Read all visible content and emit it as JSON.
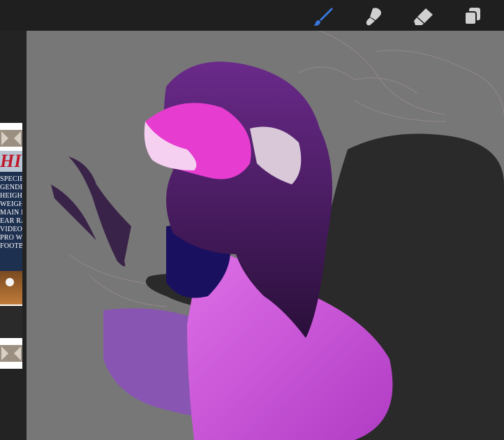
{
  "toolbar": {
    "tools": [
      {
        "name": "brush",
        "icon": "brush-icon",
        "active": true
      },
      {
        "name": "smudge",
        "icon": "smudge-icon",
        "active": false
      },
      {
        "name": "eraser",
        "icon": "eraser-icon",
        "active": false
      },
      {
        "name": "layers",
        "icon": "layers-icon",
        "active": false
      }
    ],
    "active_color": "#3a78e0",
    "inactive_color": "#d0d0d0"
  },
  "reference_panel": {
    "title_fragment": "HI",
    "text_lines": [
      "SPECIE",
      "GENDE",
      "HEIGH",
      "WEIGH",
      "MAIN I",
      "EAR RA",
      "VIDEO G",
      "PRO W",
      "FOOTB"
    ]
  },
  "canvas": {
    "background": "#777777"
  }
}
